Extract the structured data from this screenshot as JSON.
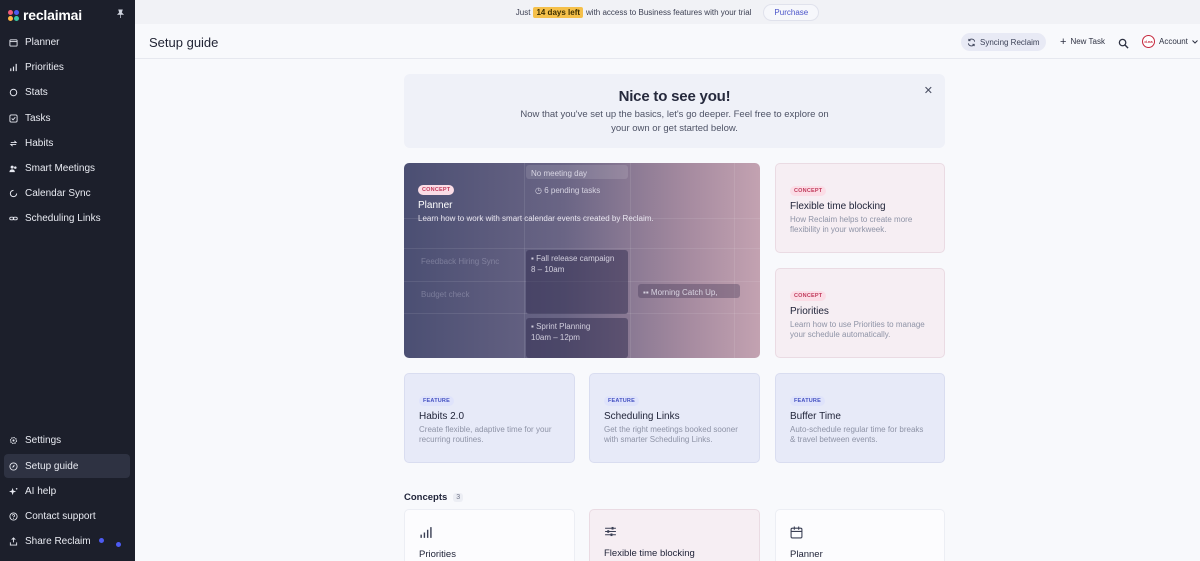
{
  "app": {
    "logo_text": "reclaimai",
    "logo_colors": [
      "#ef5b7a",
      "#4d5bf2",
      "#ffb743",
      "#38c7a4"
    ]
  },
  "sidebar": {
    "top_items": [
      {
        "label": "Planner",
        "icon": "calendar-icon"
      },
      {
        "label": "Priorities",
        "icon": "bar-chart-icon"
      },
      {
        "label": "Stats",
        "icon": "stats-icon"
      },
      {
        "label": "Tasks",
        "icon": "checkbox-icon"
      },
      {
        "label": "Habits",
        "icon": "repeat-icon"
      },
      {
        "label": "Smart Meetings",
        "icon": "people-icon"
      },
      {
        "label": "Calendar Sync",
        "icon": "sync-icon"
      },
      {
        "label": "Scheduling Links",
        "icon": "link-icon"
      }
    ],
    "bottom_items": [
      {
        "label": "Settings",
        "icon": "gear-icon"
      },
      {
        "label": "Setup guide",
        "icon": "compass-icon",
        "active": true
      },
      {
        "label": "AI help",
        "icon": "sparkle-icon"
      },
      {
        "label": "Contact support",
        "icon": "help-icon"
      },
      {
        "label": "Share Reclaim",
        "icon": "share-icon"
      }
    ]
  },
  "banner": {
    "prefix": "Just",
    "highlight": "14 days left",
    "suffix": "with access to Business features with your trial",
    "purchase_label": "Purchase"
  },
  "header": {
    "title": "Setup guide",
    "sync_label": "Syncing Reclaim",
    "new_task_label": "New Task",
    "account_label": "Account",
    "avatar_text": "d.na"
  },
  "welcome": {
    "title": "Nice to see you!",
    "body": "Now that you've set up the basics, let's go deeper. Feel free to explore on your own or get started below."
  },
  "featured": {
    "planner": {
      "tag": "CONCEPT",
      "title": "Planner",
      "desc": "Learn how to work with smart calendar events created by Reclaim.",
      "ghost_events": {
        "no_meeting": "No meeting day",
        "pending": "6 pending tasks",
        "fall_release": "Fall release campaign",
        "fall_release_time": "8 – 10am",
        "catch_up": "Morning Catch Up,",
        "sprint": "Sprint Planning",
        "sprint_time": "10am – 12pm",
        "left_a": "Feedback Hiring Sync",
        "left_b": "Budget check"
      }
    },
    "flexible": {
      "tag": "CONCEPT",
      "title": "Flexible time blocking",
      "desc": "How Reclaim helps to create more flexibility in your workweek."
    },
    "priorities": {
      "tag": "CONCEPT",
      "title": "Priorities",
      "desc": "Learn how to use Priorities to manage your schedule automatically."
    }
  },
  "features": [
    {
      "tag": "FEATURE",
      "title": "Habits 2.0",
      "desc": "Create flexible, adaptive time for your recurring routines."
    },
    {
      "tag": "FEATURE",
      "title": "Scheduling Links",
      "desc": "Get the right meetings booked sooner with smarter Scheduling Links."
    },
    {
      "tag": "FEATURE",
      "title": "Buffer Time",
      "desc": "Auto-schedule regular time for breaks & travel between events."
    }
  ],
  "concepts": {
    "label": "Concepts",
    "count": "3",
    "items": [
      {
        "title": "Priorities",
        "icon": "bar-chart-icon"
      },
      {
        "title": "Flexible time blocking",
        "icon": "sliders-icon"
      },
      {
        "title": "Planner",
        "icon": "calendar-icon"
      }
    ]
  }
}
